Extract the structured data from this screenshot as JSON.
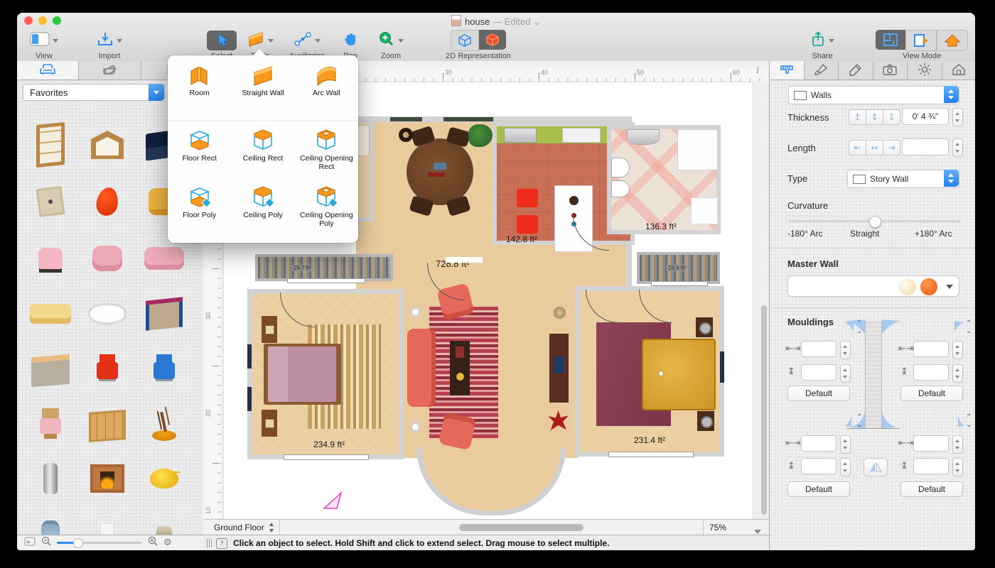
{
  "window": {
    "title": "house",
    "edited_suffix": "— Edited"
  },
  "toolbar": {
    "view": "View",
    "import": "Import",
    "select": "Select",
    "tools": "Tools",
    "auxiliaries": "Auxiliaries",
    "pan": "Pan",
    "zoom": "Zoom",
    "representation": "2D Representation",
    "share": "Share",
    "view_mode": "View Mode"
  },
  "tools_popover": {
    "groups": [
      [
        {
          "id": "room",
          "label": "Room"
        },
        {
          "id": "straight-wall",
          "label": "Straight Wall"
        },
        {
          "id": "arc-wall",
          "label": "Arc Wall"
        }
      ],
      [
        {
          "id": "floor-rect",
          "label": "Floor Rect"
        },
        {
          "id": "ceiling-rect",
          "label": "Ceiling Rect"
        },
        {
          "id": "ceiling-opening-rect",
          "label": "Ceiling Opening Rect"
        }
      ],
      [
        {
          "id": "floor-poly",
          "label": "Floor Poly"
        },
        {
          "id": "ceiling-poly",
          "label": "Ceiling Poly"
        },
        {
          "id": "ceiling-opening-poly",
          "label": "Ceiling Opening Poly"
        }
      ]
    ]
  },
  "sidebar": {
    "filter_value": "Favorites",
    "items": [
      "glazed-door",
      "arched-window",
      "tv-stand",
      "wall-clock",
      "egg-chair",
      "yellow-armchair",
      "pink-chair",
      "pink-armchair",
      "pink-sofa",
      "yellow-sofa",
      "bathtub",
      "blue-bed",
      "gray-bed",
      "red-chair",
      "blue-chair",
      "wooden-chair",
      "shelving-unit",
      "bonsai-tree",
      "silver-urn",
      "fireplace",
      "teapot",
      "blue-jar",
      "floor-lamp",
      "bedside-lamp"
    ]
  },
  "canvas": {
    "ruler_h": [
      "30",
      "40",
      "50",
      "60"
    ],
    "ruler_v": [
      "30",
      "20",
      "10"
    ],
    "info_icon": "i",
    "rooms": {
      "living": "728.8 ft²",
      "kitchen": "142.8 ft²",
      "bathroom": "136.3 ft²",
      "bedroom_left": "234.9 ft²",
      "bedroom_right": "231.4 ft²",
      "closet_left": "28.7 ft²",
      "closet_right": "26.9 ft²"
    },
    "floor_selector": "Ground Floor",
    "zoom_level": "75%"
  },
  "inspector": {
    "category": "Walls",
    "thickness_label": "Thickness",
    "thickness_value": "0' 4 ¾\"",
    "length_label": "Length",
    "length_value": "",
    "type_label": "Type",
    "type_value": "Story Wall",
    "curvature_label": "Curvature",
    "curvature_min": "-180° Arc",
    "curvature_mid": "Straight",
    "curvature_max": "+180° Arc",
    "master_wall_label": "Master Wall",
    "mouldings_label": "Mouldings",
    "default_label": "Default"
  },
  "statusbar": {
    "message": "Click an object to select. Hold Shift and click to extend select. Drag mouse to select multiple."
  }
}
